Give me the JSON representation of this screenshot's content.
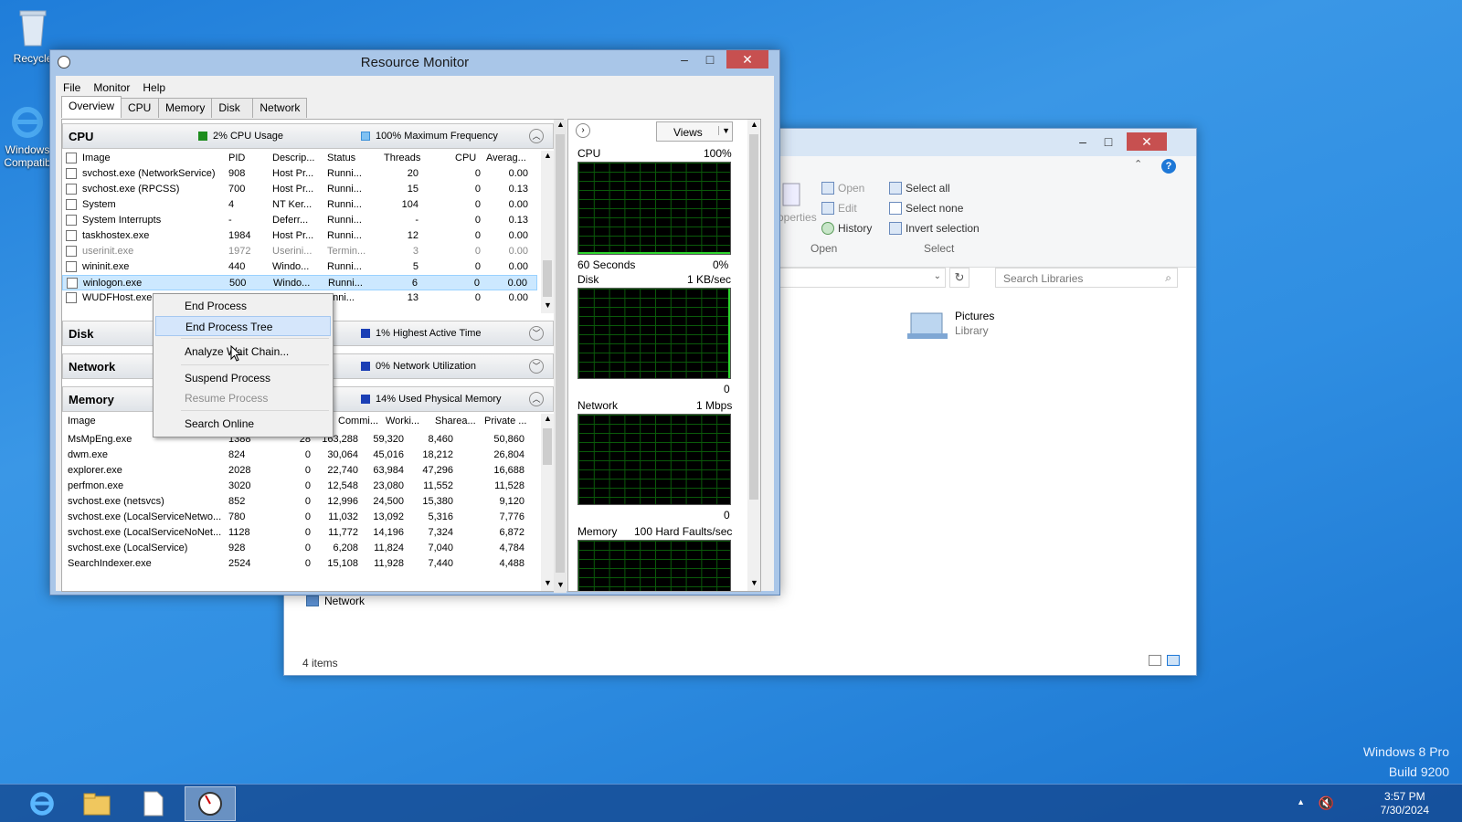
{
  "desktop": {
    "recycle_label": "Recycle",
    "ie_label": "Windows Compatib",
    "watermark_line1": "Windows 8 Pro",
    "watermark_line2": "Build 9200"
  },
  "taskbar": {
    "time": "3:57 PM",
    "date": "7/30/2024",
    "items": [
      "internet-explorer",
      "file-explorer",
      "notepad",
      "resource-monitor"
    ]
  },
  "explorer": {
    "ribbon": {
      "properties": "Properties",
      "open": "Open",
      "edit": "Edit",
      "history": "History",
      "open_group": "Open",
      "select_all": "Select all",
      "select_none": "Select none",
      "invert_selection": "Invert selection",
      "select_group": "Select"
    },
    "search_placeholder": "Search Libraries",
    "library_name": "Pictures",
    "library_type": "Library",
    "nav_network": "Network",
    "status": "4 items"
  },
  "rm": {
    "title": "Resource Monitor",
    "menu": [
      "File",
      "Monitor",
      "Help"
    ],
    "tabs": [
      "Overview",
      "CPU",
      "Memory",
      "Disk",
      "Network"
    ],
    "cpu": {
      "name": "CPU",
      "usage": "2% CPU Usage",
      "freq": "100% Maximum Frequency",
      "columns": [
        "Image",
        "PID",
        "Descrip...",
        "Status",
        "Threads",
        "CPU",
        "Averag..."
      ],
      "rows": [
        [
          "svchost.exe (NetworkService)",
          "908",
          "Host Pr...",
          "Runni...",
          "20",
          "0",
          "0.00"
        ],
        [
          "svchost.exe (RPCSS)",
          "700",
          "Host Pr...",
          "Runni...",
          "15",
          "0",
          "0.13"
        ],
        [
          "System",
          "4",
          "NT Ker...",
          "Runni...",
          "104",
          "0",
          "0.00"
        ],
        [
          "System Interrupts",
          "-",
          "Deferr...",
          "Runni...",
          "-",
          "0",
          "0.13"
        ],
        [
          "taskhostex.exe",
          "1984",
          "Host Pr...",
          "Runni...",
          "12",
          "0",
          "0.00"
        ],
        [
          "userinit.exe",
          "1972",
          "Userini...",
          "Termin...",
          "3",
          "0",
          "0.00"
        ],
        [
          "wininit.exe",
          "440",
          "Windo...",
          "Runni...",
          "5",
          "0",
          "0.00"
        ],
        [
          "winlogon.exe",
          "500",
          "Windo...",
          "Runni...",
          "6",
          "0",
          "0.00"
        ],
        [
          "WUDFHost.exe",
          "",
          "",
          "unni...",
          "13",
          "0",
          "0.00"
        ]
      ]
    },
    "disk": {
      "name": "Disk",
      "stat": "1% Highest Active Time"
    },
    "network": {
      "name": "Network",
      "stat": "0% Network Utilization"
    },
    "memory": {
      "name": "Memory",
      "stat": "14% Used Physical Memory",
      "columns": [
        "Image",
        "",
        "",
        "Commi...",
        "Worki...",
        "Sharea...",
        "Private ..."
      ],
      "rows": [
        [
          "MsMpEng.exe",
          "1388",
          "28",
          "163,288",
          "59,320",
          "8,460",
          "50,860"
        ],
        [
          "dwm.exe",
          "824",
          "0",
          "30,064",
          "45,016",
          "18,212",
          "26,804"
        ],
        [
          "explorer.exe",
          "2028",
          "0",
          "22,740",
          "63,984",
          "47,296",
          "16,688"
        ],
        [
          "perfmon.exe",
          "3020",
          "0",
          "12,548",
          "23,080",
          "11,552",
          "11,528"
        ],
        [
          "svchost.exe (netsvcs)",
          "852",
          "0",
          "12,996",
          "24,500",
          "15,380",
          "9,120"
        ],
        [
          "svchost.exe (LocalServiceNetwo...",
          "780",
          "0",
          "11,032",
          "13,092",
          "5,316",
          "7,776"
        ],
        [
          "svchost.exe (LocalServiceNoNet...",
          "1128",
          "0",
          "11,772",
          "14,196",
          "7,324",
          "6,872"
        ],
        [
          "svchost.exe (LocalService)",
          "928",
          "0",
          "6,208",
          "11,824",
          "7,040",
          "4,784"
        ],
        [
          "SearchIndexer.exe",
          "2524",
          "0",
          "15,108",
          "11,928",
          "7,440",
          "4,488"
        ]
      ]
    },
    "graphs": {
      "views": "Views",
      "cpu_label": "CPU",
      "cpu_max": "100%",
      "cpu_time": "60 Seconds",
      "cpu_min": "0%",
      "disk_label": "Disk",
      "disk_max": "1 KB/sec",
      "disk_min": "0",
      "net_label": "Network",
      "net_max": "1 Mbps",
      "net_min": "0",
      "mem_label": "Memory",
      "mem_max": "100 Hard Faults/sec"
    },
    "context_menu": [
      "End Process",
      "End Process Tree",
      "Analyze Wait Chain...",
      "Suspend Process",
      "Resume Process",
      "Search Online"
    ]
  },
  "colors": {
    "cpu_usage": "#1d8c1d",
    "freq": "#3b8fd8",
    "stat_blue": "#1b3fb5",
    "graph_line": "#2dd42d"
  }
}
